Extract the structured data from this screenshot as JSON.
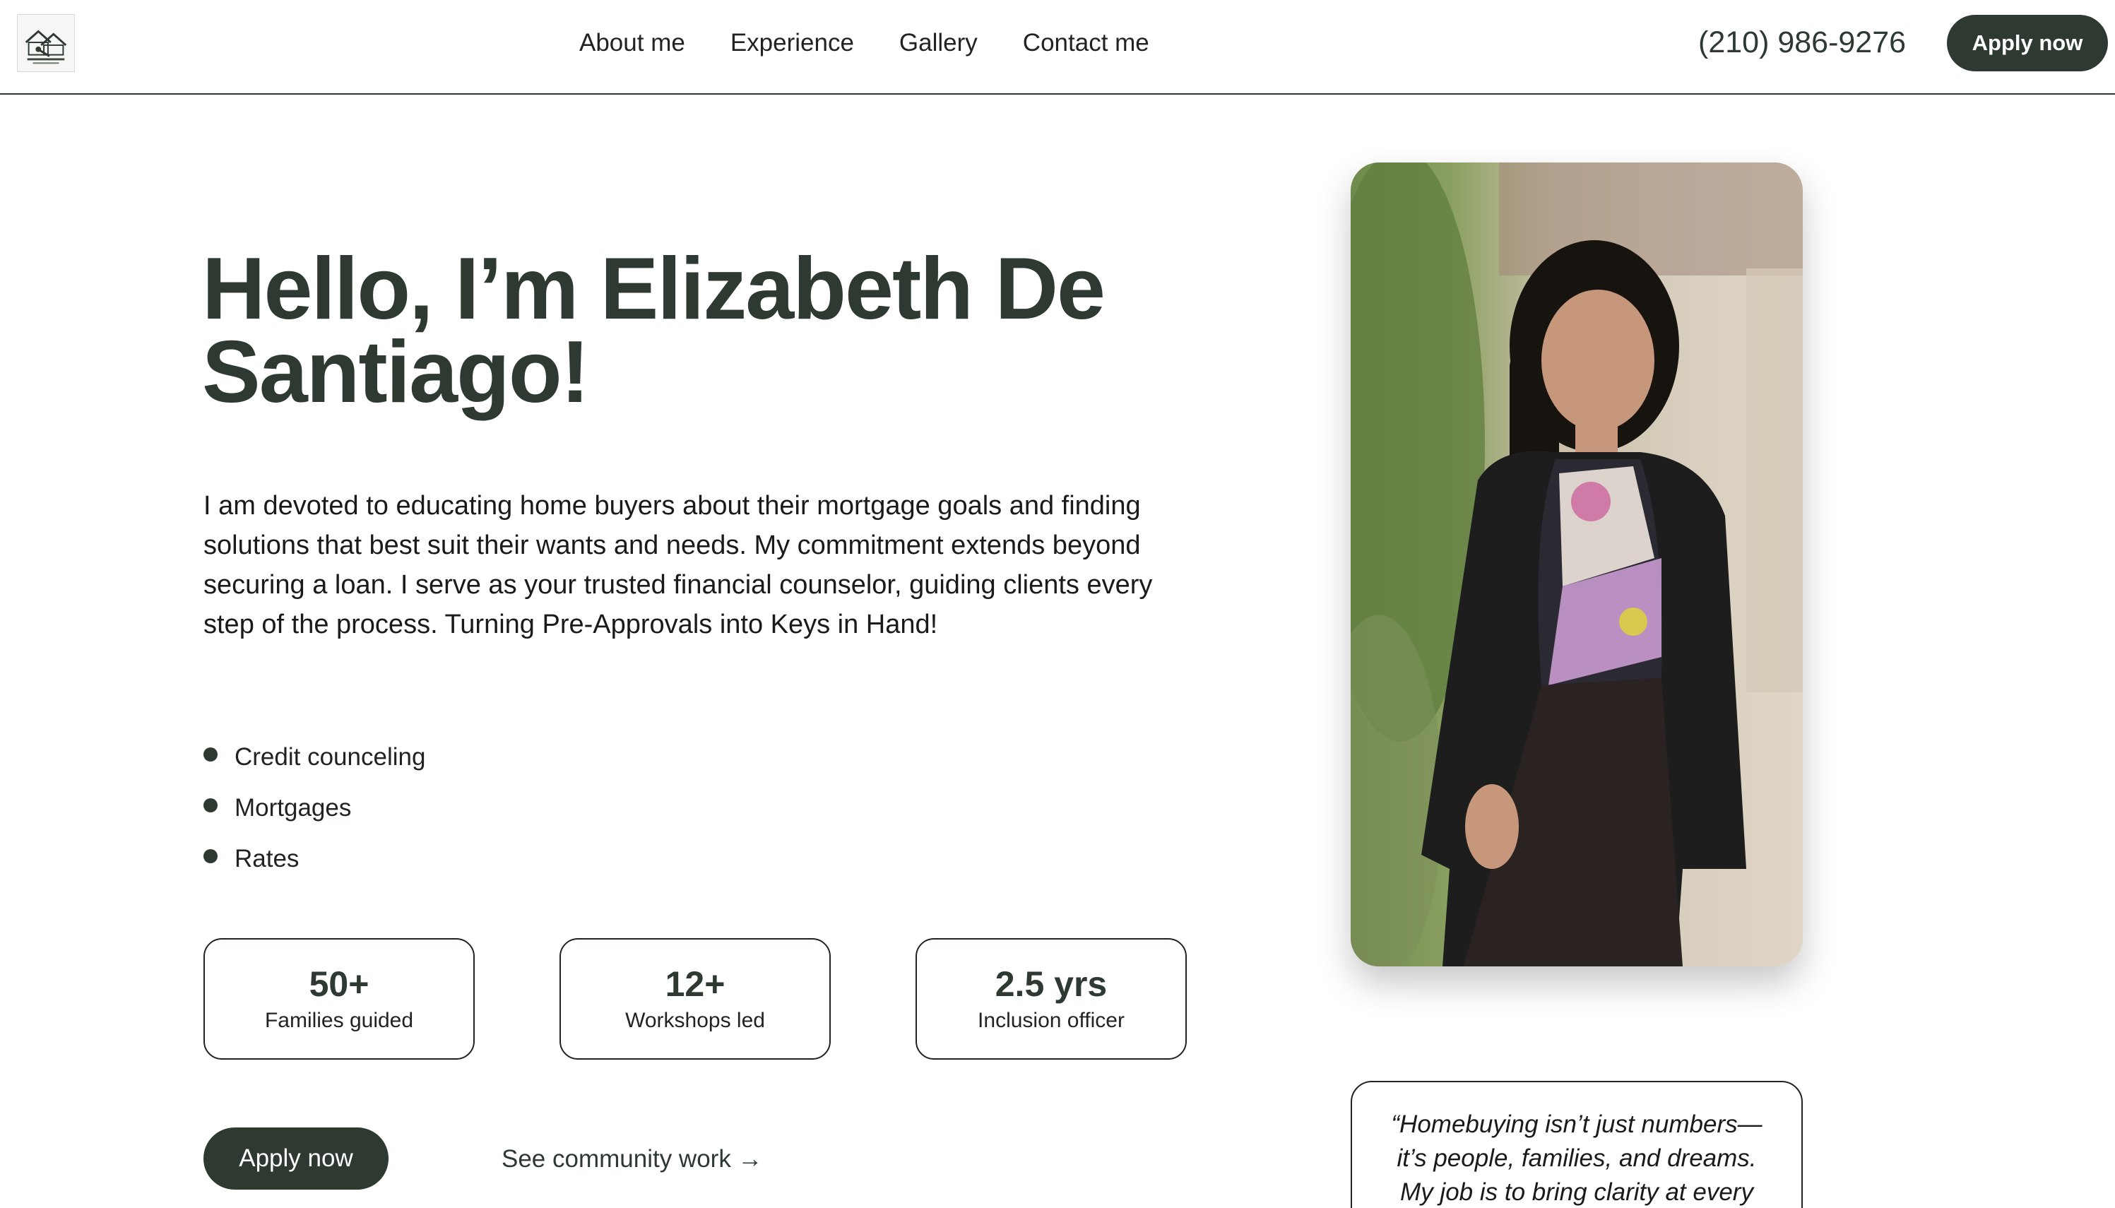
{
  "nav": {
    "logo_icon": "house-key-logo-icon",
    "links": [
      "About me",
      "Experience",
      "Gallery",
      "Contact me"
    ],
    "phone": "(210) 986-9276",
    "apply_label": "Apply now"
  },
  "hero": {
    "headline": "Hello, I’m Elizabeth De Santiago!",
    "intro": "I am devoted to educating home buyers about their mortgage goals and finding solutions that best suit their wants and needs. My commitment extends beyond securing a loan. I serve as your trusted financial counselor, guiding clients every step of the process. Turning Pre-Approvals into Keys in Hand!",
    "bullets": [
      "Credit counceling",
      "Mortgages",
      "Rates"
    ],
    "stats": [
      {
        "value": "50+",
        "label": "Families guided"
      },
      {
        "value": "12+",
        "label": "Workshops led"
      },
      {
        "value": "2.5 yrs",
        "label": "Inclusion officer"
      }
    ],
    "apply_label": "Apply now",
    "community_link": "See community work →"
  },
  "quote": {
    "text": "“Homebuying isn’t just numbers—it’s people, families, and dreams. My job is to bring clarity at every"
  },
  "colors": {
    "brand_dark_green": "#2e3a31",
    "text": "#1a1a1a",
    "background": "#ffffff"
  }
}
